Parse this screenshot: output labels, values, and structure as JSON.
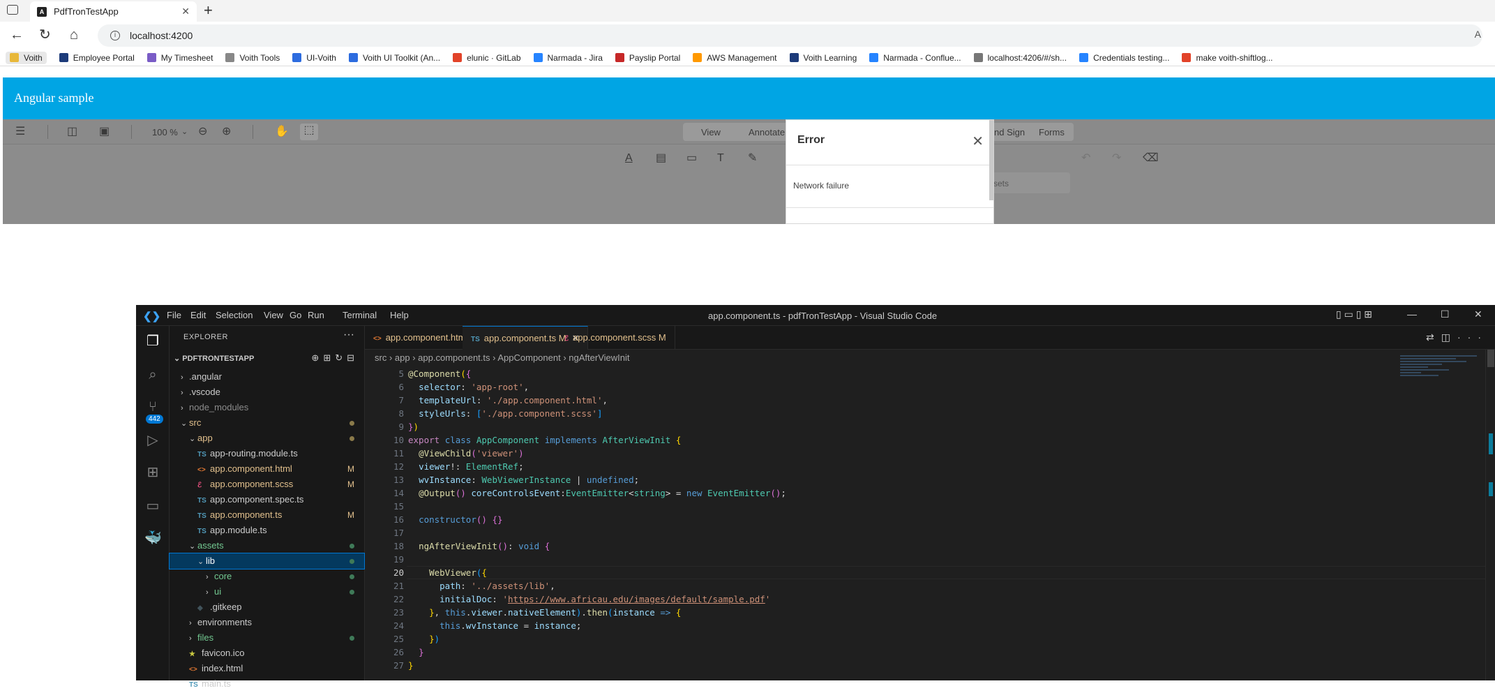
{
  "browser": {
    "tab_title": "PdfTronTestApp",
    "tab_close": "✕",
    "new_tab": "+",
    "url": "localhost:4200",
    "read_aloud": "A",
    "bookmarks": [
      {
        "label": "Voith",
        "color": "#e8b83a"
      },
      {
        "label": "Employee Portal",
        "color": "#1d3b7a"
      },
      {
        "label": "My Timesheet",
        "color": "#7a5cc6"
      },
      {
        "label": "Voith Tools",
        "color": "#888888"
      },
      {
        "label": "UI-Voith",
        "color": "#2d6cdf"
      },
      {
        "label": "Voith UI Toolkit (An...",
        "color": "#2d6cdf"
      },
      {
        "label": "elunic · GitLab",
        "color": "#e24329"
      },
      {
        "label": "Narmada - Jira",
        "color": "#2684ff"
      },
      {
        "label": "Payslip Portal",
        "color": "#c62828"
      },
      {
        "label": "AWS Management",
        "color": "#ff9900"
      },
      {
        "label": "Voith Learning",
        "color": "#1d3b7a"
      },
      {
        "label": "Narmada - Conflue...",
        "color": "#2684ff"
      },
      {
        "label": "localhost:4206/#/sh...",
        "color": "#777777"
      },
      {
        "label": "Credentials testing...",
        "color": "#2684ff"
      },
      {
        "label": "make voith-shiftlog...",
        "color": "#e24329"
      }
    ]
  },
  "app": {
    "header_title": "Angular sample",
    "viewer": {
      "zoom": "100 %",
      "ribbon_tabs": [
        "View",
        "Annotate",
        "nd Sign",
        "Forms"
      ],
      "search_placeholder": "sets"
    },
    "error_modal": {
      "title": "Error",
      "close": "✕",
      "message": "Network failure"
    }
  },
  "vscode": {
    "window_title": "app.component.ts - pdfTronTestApp - Visual Studio Code",
    "menu": [
      "File",
      "Edit",
      "Selection",
      "View",
      "Go",
      "Run",
      "Terminal",
      "Help"
    ],
    "scm_badge": "442",
    "explorer_title": "EXPLORER",
    "project": "PDFTRONTESTAPP",
    "tree": [
      {
        "label": ".angular",
        "indent": 1,
        "type": "folder",
        "open": false,
        "color": "#cccccc"
      },
      {
        "label": ".vscode",
        "indent": 1,
        "type": "folder",
        "open": false,
        "color": "#cccccc"
      },
      {
        "label": "node_modules",
        "indent": 1,
        "type": "folder",
        "open": false,
        "color": "#8b8b8b"
      },
      {
        "label": "src",
        "indent": 1,
        "type": "folder",
        "open": true,
        "color": "#e2c08d",
        "dot": "#8a7a4a"
      },
      {
        "label": "app",
        "indent": 2,
        "type": "folder",
        "open": true,
        "color": "#e2c08d",
        "dot": "#8a7a4a"
      },
      {
        "label": "app-routing.module.ts",
        "indent": 3,
        "type": "ts",
        "color": "#cccccc"
      },
      {
        "label": "app.component.html",
        "indent": 3,
        "type": "html",
        "color": "#e2c08d",
        "status": "M"
      },
      {
        "label": "app.component.scss",
        "indent": 3,
        "type": "scss",
        "color": "#e2c08d",
        "status": "M"
      },
      {
        "label": "app.component.spec.ts",
        "indent": 3,
        "type": "ts",
        "color": "#cccccc"
      },
      {
        "label": "app.component.ts",
        "indent": 3,
        "type": "ts",
        "color": "#e2c08d",
        "status": "M"
      },
      {
        "label": "app.module.ts",
        "indent": 3,
        "type": "ts",
        "color": "#cccccc"
      },
      {
        "label": "assets",
        "indent": 2,
        "type": "folder",
        "open": true,
        "color": "#73c991",
        "dot": "#3f7a58"
      },
      {
        "label": "lib",
        "indent": 3,
        "type": "folder",
        "open": true,
        "color": "#ffffff",
        "dot": "#3f7a58",
        "selected": true
      },
      {
        "label": "core",
        "indent": 4,
        "type": "folder",
        "open": false,
        "color": "#73c991",
        "dot": "#3f7a58"
      },
      {
        "label": "ui",
        "indent": 4,
        "type": "folder",
        "open": false,
        "color": "#73c991",
        "dot": "#3f7a58"
      },
      {
        "label": ".gitkeep",
        "indent": 3,
        "type": "git",
        "color": "#cccccc"
      },
      {
        "label": "environments",
        "indent": 2,
        "type": "folder",
        "open": false,
        "color": "#cccccc"
      },
      {
        "label": "files",
        "indent": 2,
        "type": "folder",
        "open": false,
        "color": "#73c991",
        "dot": "#3f7a58"
      },
      {
        "label": "favicon.ico",
        "indent": 2,
        "type": "ico",
        "color": "#cccccc"
      },
      {
        "label": "index.html",
        "indent": 2,
        "type": "html",
        "color": "#cccccc"
      },
      {
        "label": "main.ts",
        "indent": 2,
        "type": "ts",
        "color": "#cccccc"
      }
    ],
    "tabs": [
      {
        "label": "app.component.html",
        "type": "html",
        "status": "M",
        "active": false
      },
      {
        "label": "app.component.ts",
        "type": "ts",
        "status": "M",
        "active": true
      },
      {
        "label": "app.component.scss",
        "type": "scss",
        "status": "M",
        "active": false
      }
    ],
    "breadcrumb": [
      "src",
      "app",
      "app.component.ts",
      "AppComponent",
      "ngAfterViewInit"
    ],
    "current_line": 20,
    "code": [
      {
        "n": 5,
        "html": "<span class='dec'>@Component</span><span class='br1'>(</span><span class='br2'>{</span>"
      },
      {
        "n": 6,
        "html": "  <span class='var'>selector</span><span class='pl'>: </span><span class='str'>'app-root'</span><span class='pl'>,</span>"
      },
      {
        "n": 7,
        "html": "  <span class='var'>templateUrl</span><span class='pl'>: </span><span class='str'>'./app.component.html'</span><span class='pl'>,</span>"
      },
      {
        "n": 8,
        "html": "  <span class='var'>styleUrls</span><span class='pl'>: </span><span class='br3'>[</span><span class='str'>'./app.component.scss'</span><span class='br3'>]</span>"
      },
      {
        "n": 9,
        "html": "<span class='br2'>}</span><span class='br1'>)</span>"
      },
      {
        "n": 10,
        "html": "<span class='kp'>export</span> <span class='kw'>class</span> <span class='cls'>AppComponent</span> <span class='kw'>implements</span> <span class='cls'>AfterViewInit</span> <span class='br1'>{</span>"
      },
      {
        "n": 11,
        "html": "  <span class='dec'>@ViewChild</span><span class='br2'>(</span><span class='str'>'viewer'</span><span class='br2'>)</span>"
      },
      {
        "n": 12,
        "html": "  <span class='var'>viewer</span><span class='pl'>!: </span><span class='cls'>ElementRef</span><span class='pl'>;</span>"
      },
      {
        "n": 13,
        "html": "  <span class='var'>wvInstance</span><span class='pl'>: </span><span class='cls'>WebViewerInstance</span> <span class='pl'>|</span> <span class='kw'>undefined</span><span class='pl'>;</span>"
      },
      {
        "n": 14,
        "html": "  <span class='dec'>@Output</span><span class='br2'>()</span> <span class='var'>coreControlsEvent</span><span class='pl'>:</span><span class='cls'>EventEmitter</span><span class='pl'>&lt;</span><span class='cls'>string</span><span class='pl'>&gt; = </span><span class='kw'>new</span> <span class='cls'>EventEmitter</span><span class='br2'>()</span><span class='pl'>;</span>"
      },
      {
        "n": 15,
        "html": ""
      },
      {
        "n": 16,
        "html": "  <span class='kw'>constructor</span><span class='br2'>()</span> <span class='br2'>{}</span>"
      },
      {
        "n": 17,
        "html": ""
      },
      {
        "n": 18,
        "html": "  <span class='fn'>ngAfterViewInit</span><span class='br2'>()</span><span class='pl'>: </span><span class='kw'>void</span> <span class='br2'>{</span>"
      },
      {
        "n": 19,
        "html": ""
      },
      {
        "n": 20,
        "html": "    <span class='fn'>WebViewer</span><span class='br3'>(</span><span class='br1'>{</span>"
      },
      {
        "n": 21,
        "html": "      <span class='var'>path</span><span class='pl'>: </span><span class='str'>'../assets/lib'</span><span class='pl'>,</span>"
      },
      {
        "n": 22,
        "html": "      <span class='var'>initialDoc</span><span class='pl'>: </span><span class='str'>'</span><span class='url'>https://www.africau.edu/images/default/sample.pdf</span><span class='str'>'</span>"
      },
      {
        "n": 23,
        "html": "    <span class='br1'>}</span><span class='pl'>, </span><span class='kw'>this</span><span class='pl'>.</span><span class='var'>viewer</span><span class='pl'>.</span><span class='var'>nativeElement</span><span class='br3'>)</span><span class='pl'>.</span><span class='fn'>then</span><span class='br3'>(</span><span class='var'>instance</span> <span class='kw'>=&gt;</span> <span class='br1'>{</span>"
      },
      {
        "n": 24,
        "html": "      <span class='kw'>this</span><span class='pl'>.</span><span class='var'>wvInstance</span><span class='pl'> = </span><span class='var'>instance</span><span class='pl'>;</span>"
      },
      {
        "n": 25,
        "html": "    <span class='br1'>}</span><span class='br3'>)</span>"
      },
      {
        "n": 26,
        "html": "  <span class='br2'>}</span>"
      },
      {
        "n": 27,
        "html": "<span class='br1'>}</span>"
      }
    ]
  }
}
